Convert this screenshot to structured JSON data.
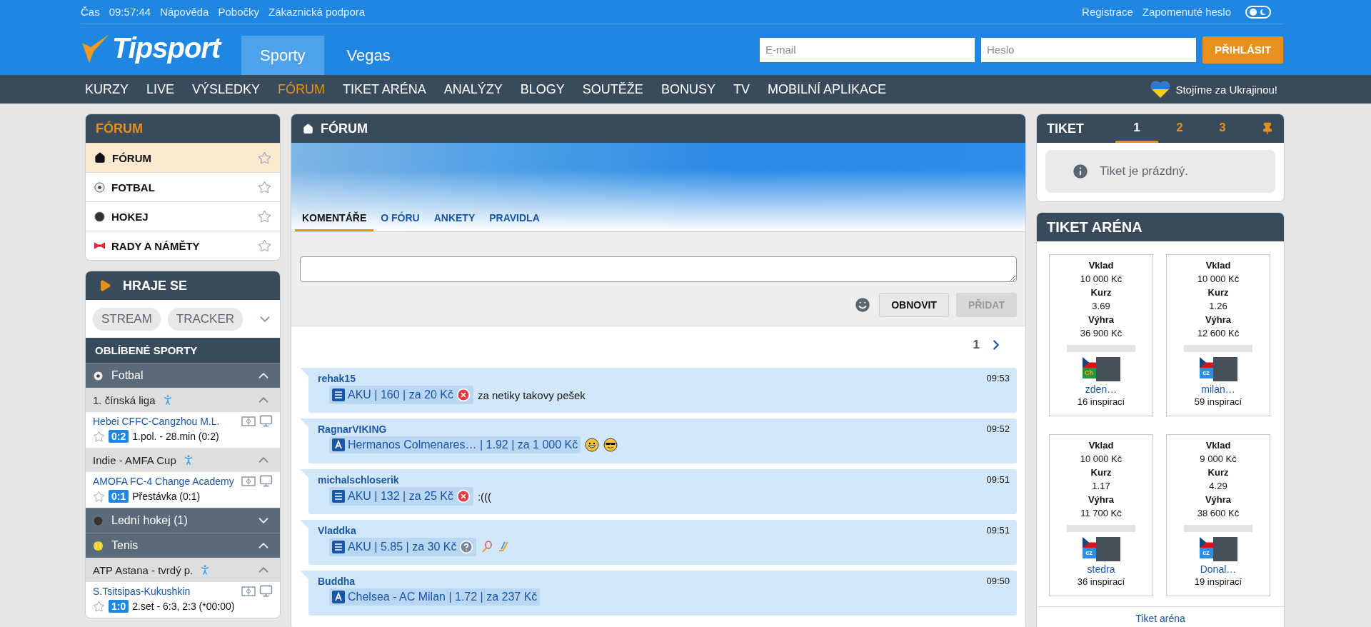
{
  "top_bar": {
    "links": [
      "Čas",
      "09:57:44",
      "Nápověda",
      "Pobočky",
      "Zákaznická podpora"
    ],
    "right_links": [
      "Registrace",
      "Zapomenuté heslo"
    ]
  },
  "header": {
    "logo": "Tipsport",
    "sections": [
      {
        "label": "Sporty",
        "selected": true
      },
      {
        "label": "Vegas",
        "selected": false
      }
    ],
    "email": {
      "placeholder": "E-mail"
    },
    "password": {
      "placeholder": "Heslo"
    },
    "login": "PŘIHLÁSIT"
  },
  "nav": {
    "items": [
      {
        "label": "KURZY",
        "selected": false
      },
      {
        "label": "LIVE",
        "selected": false
      },
      {
        "label": "VÝSLEDKY",
        "selected": false
      },
      {
        "label": "FÓRUM",
        "selected": true
      },
      {
        "label": "TIKET ARÉNA",
        "selected": false
      },
      {
        "label": "ANALÝZY",
        "selected": false
      },
      {
        "label": "BLOGY",
        "selected": false
      },
      {
        "label": "SOUTĚŽE",
        "selected": false
      },
      {
        "label": "BONUSY",
        "selected": false
      },
      {
        "label": "TV",
        "selected": false
      },
      {
        "label": "MOBILNÍ APLIKACE",
        "selected": false
      }
    ],
    "ukraine": "Stojíme za Ukrajinou!"
  },
  "forum_menu": {
    "title": "FÓRUM",
    "items": [
      {
        "label": "FÓRUM",
        "kind": "home",
        "selected": true
      },
      {
        "label": "FOTBAL",
        "kind": "football",
        "selected": false
      },
      {
        "label": "HOKEJ",
        "kind": "puck",
        "selected": false
      },
      {
        "label": "RADY A NÁMĚTY",
        "kind": "bow",
        "selected": false
      }
    ]
  },
  "live": {
    "title": "HRAJE SE",
    "filters": [
      "STREAM",
      "TRACKER"
    ],
    "favorites_title": "OBLÍBENÉ SPORTY",
    "sports": [
      {
        "name": "Fotbal",
        "kind": "football",
        "expanded": true,
        "leagues": [
          {
            "name": "1. čínská liga",
            "expanded": true,
            "matches": [
              {
                "teams": "Hebei CFFC-Cangzhou M.L.",
                "score": "0:2",
                "status": "1.pol. - 28.min (0:2)"
              }
            ]
          },
          {
            "name": "Indie - AMFA Cup",
            "expanded": true,
            "matches": [
              {
                "teams": "AMOFA FC-4 Change Academy",
                "score": "0:1",
                "status": "Přestávka (0:1)"
              }
            ]
          }
        ]
      },
      {
        "name": "Lední hokej (1)",
        "kind": "puck",
        "expanded": false
      },
      {
        "name": "Tenis",
        "kind": "tennis",
        "expanded": true,
        "leagues": [
          {
            "name": "ATP Astana - tvrdý p.",
            "expanded": true,
            "matches": [
              {
                "teams": "S.Tsitsipas-Kukushkin",
                "score": "1:0",
                "status": "2.set - 6:3, 2:3 (*00:00)"
              }
            ]
          }
        ]
      }
    ]
  },
  "forum": {
    "title": "FÓRUM",
    "tabs": [
      {
        "label": "KOMENTÁŘE",
        "selected": true
      },
      {
        "label": "O FÓRU",
        "selected": false
      },
      {
        "label": "ANKETY",
        "selected": false
      },
      {
        "label": "PRAVIDLA",
        "selected": false
      }
    ],
    "buttons": [
      {
        "label": "OBNOVIT",
        "disabled": false
      },
      {
        "label": "PŘIDAT",
        "disabled": true
      }
    ],
    "page": "1",
    "comments": [
      {
        "user": "rehak15",
        "time": "09:53",
        "ticket": {
          "kind": "aku",
          "text": "AKU | 160 | za 20 Kč"
        },
        "result": {
          "kind": "lost"
        },
        "message": "za netiky takovy pešek"
      },
      {
        "user": "RagnarVIKING",
        "time": "09:52",
        "ticket": {
          "kind": "single",
          "text": "Hermanos Colmenares… | 1.92 | za 1 000 Kč"
        },
        "emojis": [
          {
            "kind": "grin"
          },
          {
            "kind": "cool"
          }
        ]
      },
      {
        "user": "michalschloserik",
        "time": "09:51",
        "ticket": {
          "kind": "aku",
          "text": "AKU | 132 | za 25 Kč"
        },
        "result": {
          "kind": "lost"
        },
        "message": ":((("
      },
      {
        "user": "Vladdka",
        "time": "09:51",
        "ticket": {
          "kind": "aku",
          "text": "AKU | 5.85 | za 30 Kč"
        },
        "result": {
          "kind": "open"
        },
        "emojis": [
          {
            "kind": "racket"
          },
          {
            "kind": "stick"
          }
        ]
      },
      {
        "user": "Buddha",
        "time": "09:50",
        "ticket": {
          "kind": "single",
          "text": "Chelsea - AC Milan | 1.72 | za 237 Kč"
        }
      }
    ]
  },
  "ticket": {
    "title": "TIKET",
    "tabs": [
      {
        "label": "1",
        "selected": true
      },
      {
        "label": "2",
        "selected": false
      },
      {
        "label": "3",
        "selected": false
      }
    ],
    "empty": "Tiket je prázdný."
  },
  "arena": {
    "title": "TIKET ARÉNA",
    "cards": [
      {
        "stake_label": "Vklad",
        "stake": "10 000 Kč",
        "odds_label": "Kurz",
        "odds": "3.69",
        "win_label": "Výhra",
        "win": "36 900 Kč",
        "badge": {
          "kind": "club",
          "text": "Ch"
        },
        "user": "zden…",
        "inspirations": "16 inspirací"
      },
      {
        "stake_label": "Vklad",
        "stake": "10 000 Kč",
        "odds_label": "Kurz",
        "odds": "1.26",
        "win_label": "Výhra",
        "win": "12 600 Kč",
        "badge": {
          "kind": "tipsport",
          "text": "cz"
        },
        "user": "milan…",
        "inspirations": "59 inspirací"
      },
      {
        "stake_label": "Vklad",
        "stake": "10 000 Kč",
        "odds_label": "Kurz",
        "odds": "1.17",
        "win_label": "Výhra",
        "win": "11 700 Kč",
        "badge": {
          "kind": "tipsport",
          "text": "cz"
        },
        "user": "stedra",
        "inspirations": "36 inspirací"
      },
      {
        "stake_label": "Vklad",
        "stake": "9 000 Kč",
        "odds_label": "Kurz",
        "odds": "4.29",
        "win_label": "Výhra",
        "win": "38 600 Kč",
        "badge": {
          "kind": "tipsport",
          "text": "cz"
        },
        "user": "Donal…",
        "inspirations": "19 inspirací"
      }
    ],
    "footer": "Tiket aréna"
  }
}
